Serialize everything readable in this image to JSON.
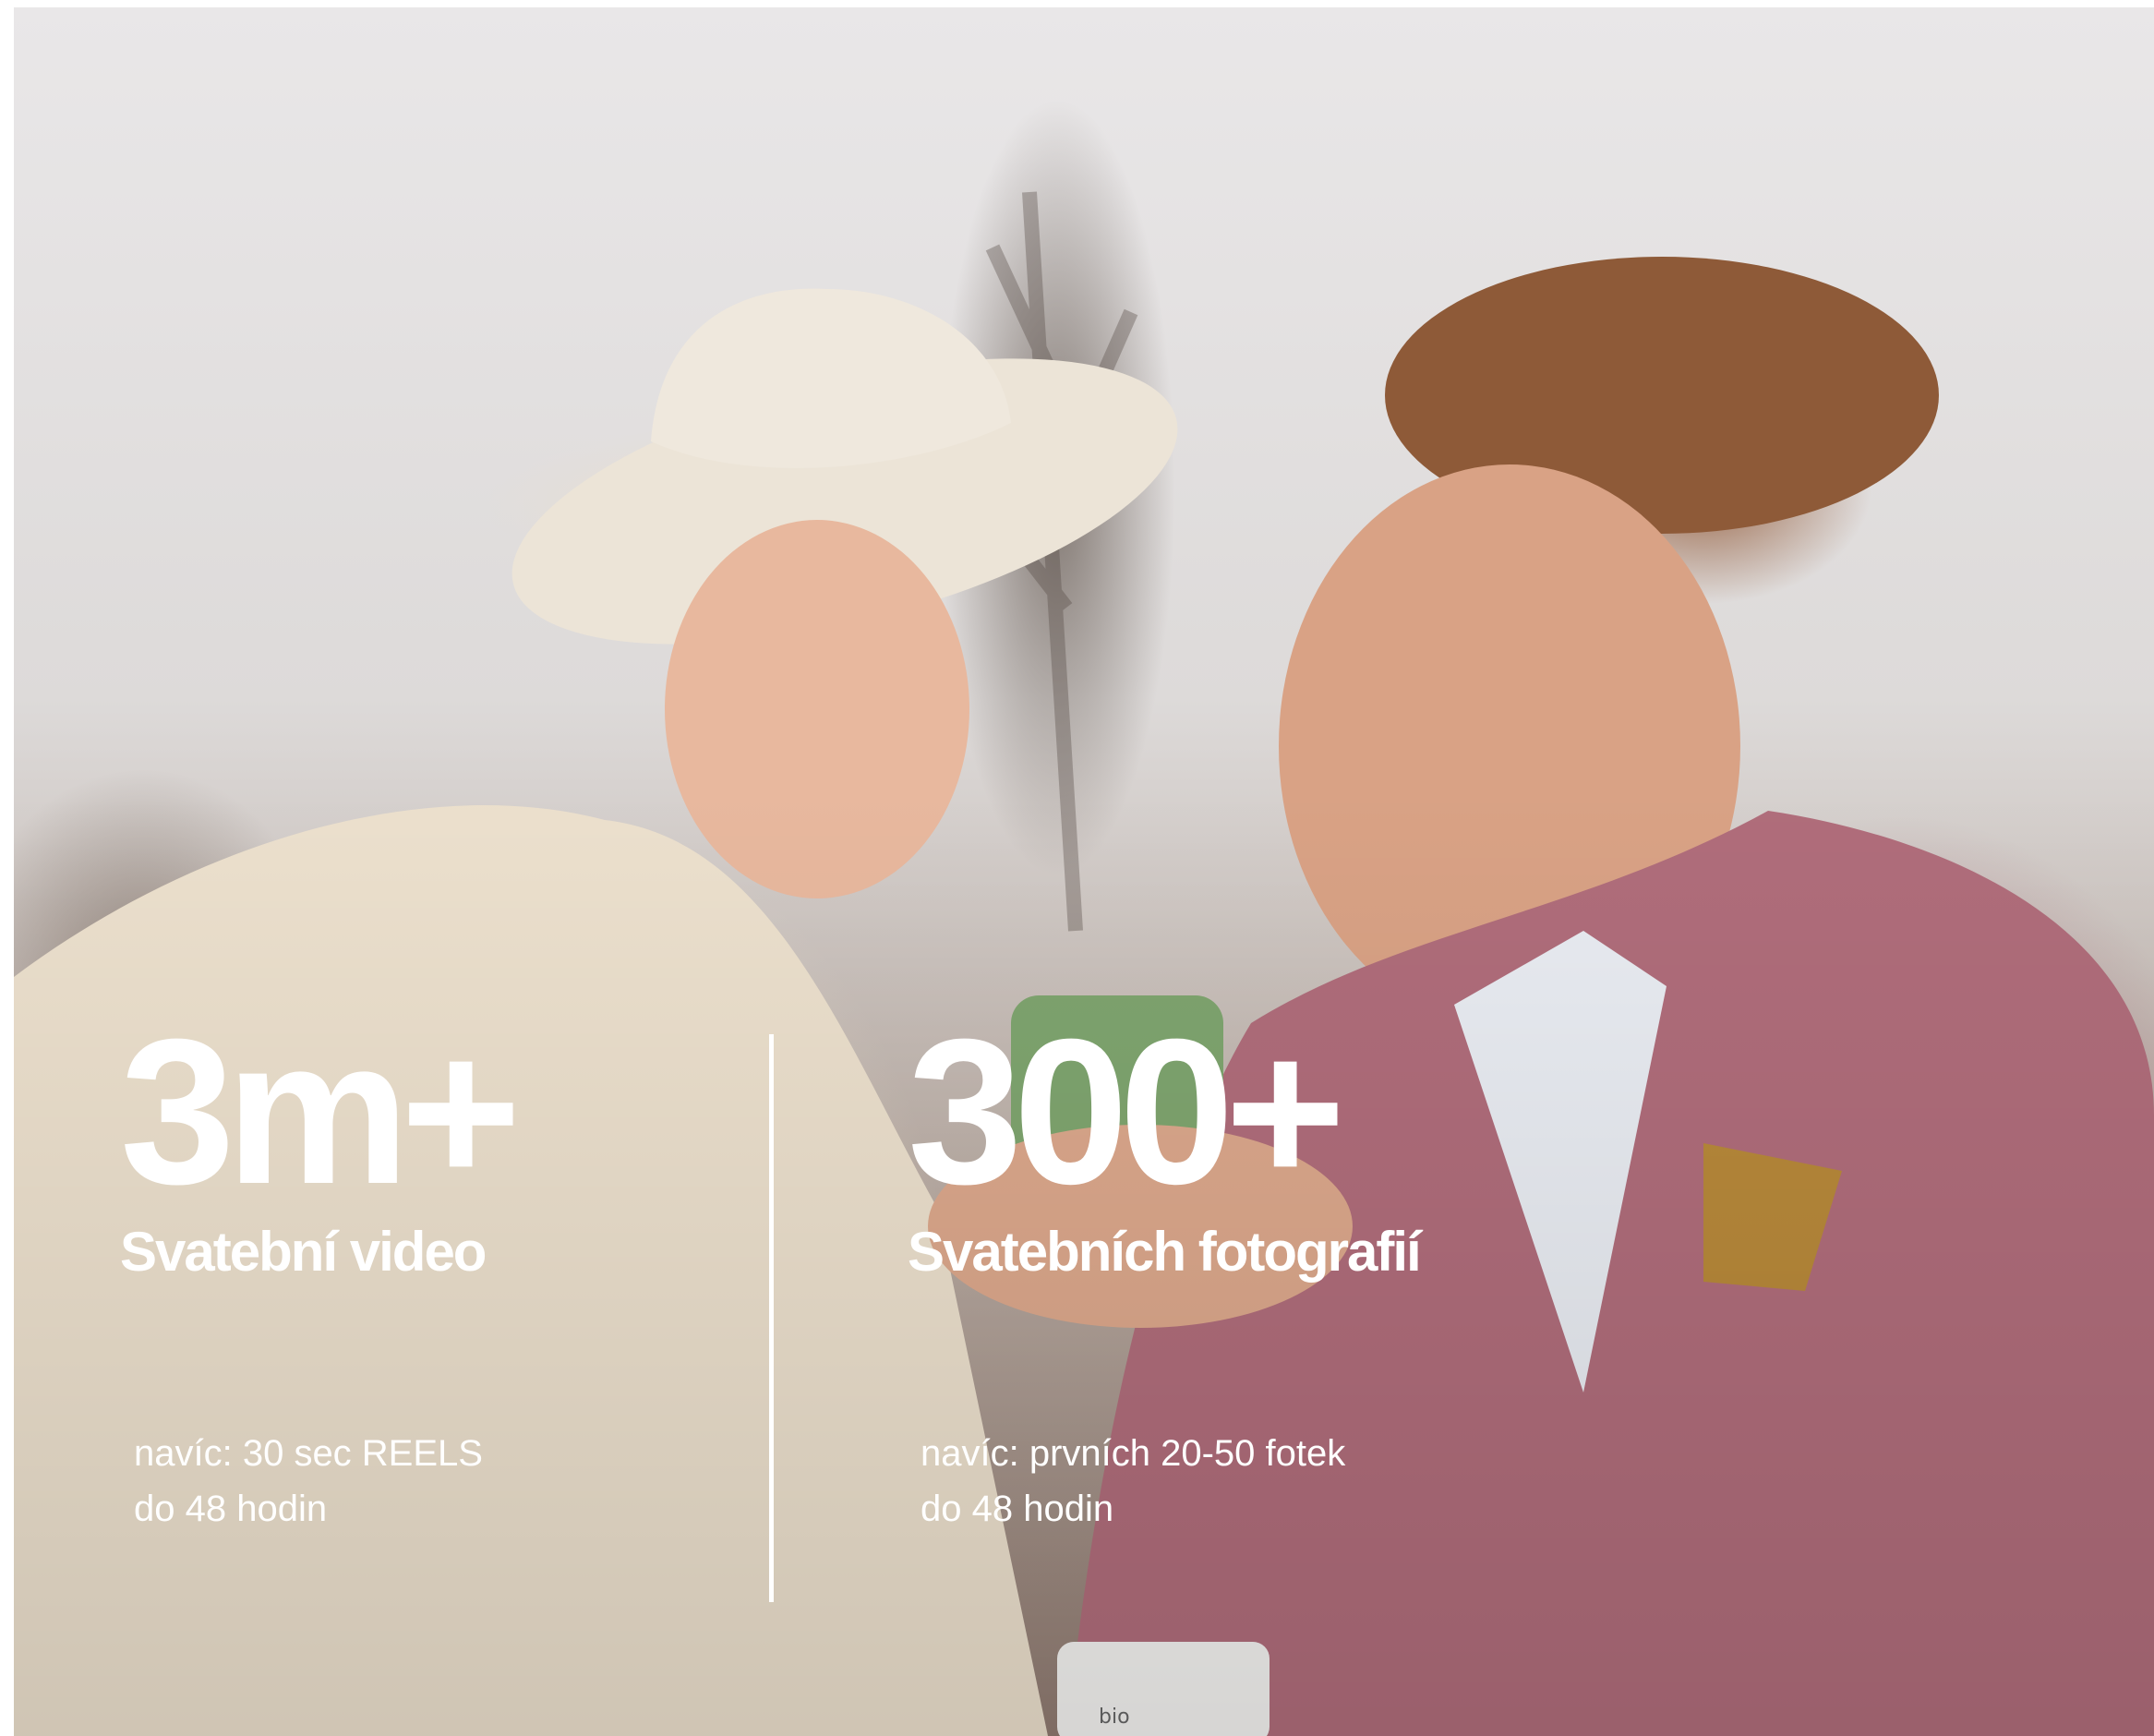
{
  "stats": [
    {
      "number": "3m+",
      "label": "Svatební video",
      "note_line_1": "navíc: 30 sec REELS",
      "note_line_2": "do 48 hodin"
    },
    {
      "number": "300+",
      "label": "Svatebních fotografií",
      "note_line_1": "navíc: prvních 20-50 fotek",
      "note_line_2": "do 48 hodin"
    }
  ],
  "photo": {
    "mug_text": "bio"
  },
  "colors": {
    "text": "#ffffff",
    "divider": "#ffffff",
    "page_background": "#ffffff"
  }
}
